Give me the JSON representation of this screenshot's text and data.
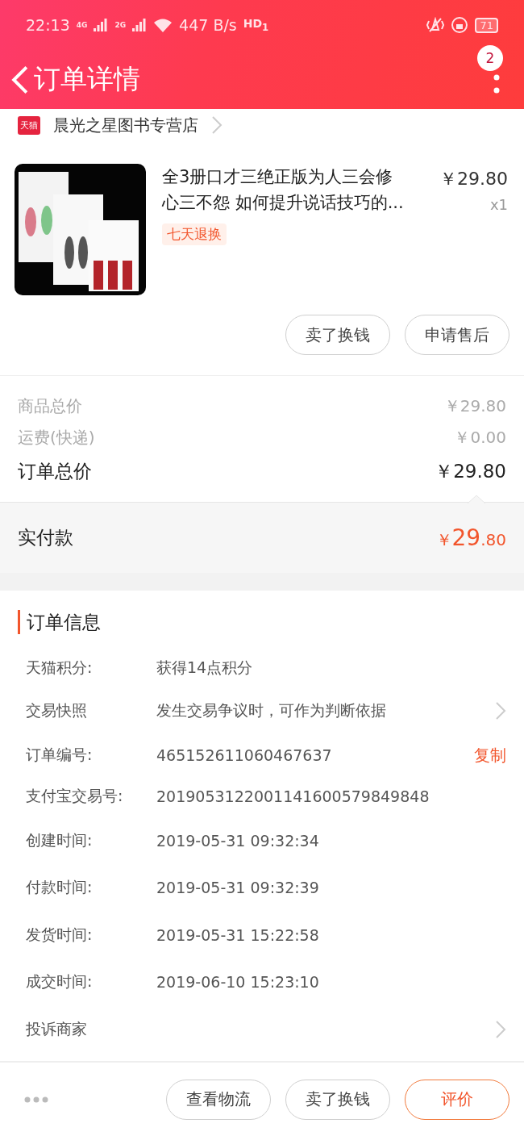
{
  "status_bar": {
    "time": "22:13",
    "sim1": "4G",
    "sim2": "2G",
    "speed": "447 B/s",
    "hd": "HD",
    "hd_sim": "1",
    "battery": "71"
  },
  "header": {
    "title": "订单详情",
    "badge": "2"
  },
  "shop": {
    "badge": "天猫",
    "name": "晨光之星图书专营店"
  },
  "product": {
    "title": "全3册口才三绝正版为人三会修心三不怨 如何提升说话技巧的...",
    "price": "￥29.80",
    "quantity": "x1",
    "tag": "七天退换"
  },
  "item_actions": [
    "卖了换钱",
    "申请售后"
  ],
  "price_rows": [
    {
      "label": "商品总价",
      "value": "￥29.80",
      "emphasis": false
    },
    {
      "label": "运费(快递)",
      "value": "￥0.00",
      "emphasis": false
    },
    {
      "label": "订单总价",
      "value": "￥29.80",
      "emphasis": true
    }
  ],
  "paid": {
    "label": "实付款",
    "currency": "￥",
    "integer": "29",
    "decimal": ".80"
  },
  "order_info": {
    "title": "订单信息",
    "rows": [
      {
        "label": "天猫积分:",
        "value": "获得14点积分",
        "kind": "plain"
      },
      {
        "label": "交易快照",
        "value": "发生交易争议时，可作为判断依据",
        "kind": "chevron"
      },
      {
        "label": "订单编号:",
        "value": "465152611060467637",
        "kind": "copy",
        "action": "复制"
      },
      {
        "label": "支付宝交易号:",
        "value": "2019053122001141600579849848",
        "kind": "plain"
      },
      {
        "label": "创建时间:",
        "value": "2019-05-31 09:32:34",
        "kind": "plain"
      },
      {
        "label": "付款时间:",
        "value": "2019-05-31 09:32:39",
        "kind": "plain"
      },
      {
        "label": "发货时间:",
        "value": "2019-05-31 15:22:58",
        "kind": "plain"
      },
      {
        "label": "成交时间:",
        "value": "2019-06-10 15:23:10",
        "kind": "plain"
      },
      {
        "label": "投诉商家",
        "kind": "chevron"
      }
    ]
  },
  "bottom_actions": [
    {
      "label": "查看物流",
      "highlight": false
    },
    {
      "label": "卖了换钱",
      "highlight": false
    },
    {
      "label": "评价",
      "highlight": true
    }
  ]
}
